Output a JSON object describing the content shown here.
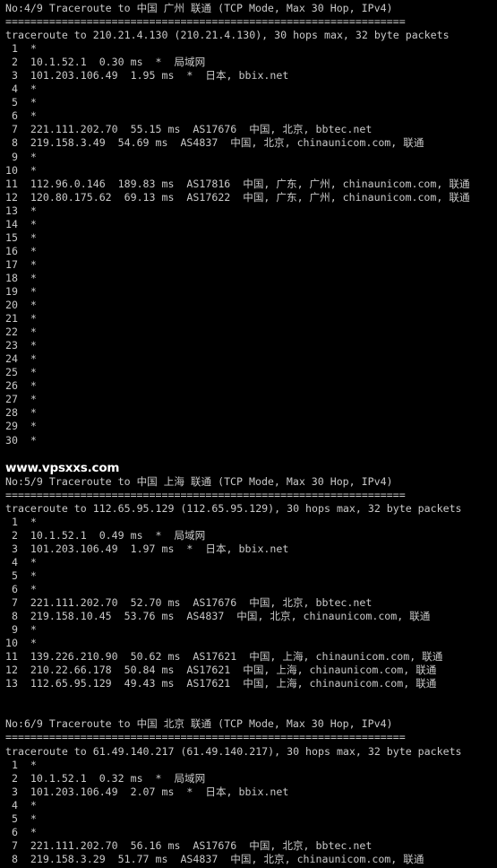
{
  "terminal": {
    "background_color": "#000000",
    "text_color": "#c9c9c9",
    "watermark_color": "#ffffff"
  },
  "watermark": {
    "text": "www.vpsxxs.com"
  },
  "sections": [
    {
      "header": "No:4/9 Traceroute to 中国 广州 联通 (TCP Mode, Max 30 Hop, IPv4)",
      "separator": "================================================================",
      "summary": "traceroute to 210.21.4.130 (210.21.4.130), 30 hops max, 32 byte packets",
      "target_ip": "210.21.4.130",
      "max_hops": "30",
      "packet_size": "32 byte",
      "hops": [
        " 1  *",
        " 2  10.1.52.1  0.30 ms  *  局域网",
        " 3  101.203.106.49  1.95 ms  *  日本, bbix.net",
        " 4  *",
        " 5  *",
        " 6  *",
        " 7  221.111.202.70  55.15 ms  AS17676  中国, 北京, bbtec.net",
        " 8  219.158.3.49  54.69 ms  AS4837  中国, 北京, chinaunicom.com, 联通",
        " 9  *",
        "10  *",
        "11  112.96.0.146  189.83 ms  AS17816  中国, 广东, 广州, chinaunicom.com, 联通",
        "12  120.80.175.62  69.13 ms  AS17622  中国, 广东, 广州, chinaunicom.com, 联通",
        "13  *",
        "14  *",
        "15  *",
        "16  *",
        "17  *",
        "18  *",
        "19  *",
        "20  *",
        "21  *",
        "22  *",
        "23  *",
        "24  *",
        "25  *",
        "26  *",
        "27  *",
        "28  *",
        "29  *",
        "30  *"
      ]
    },
    {
      "header": "No:5/9 Traceroute to 中国 上海 联通 (TCP Mode, Max 30 Hop, IPv4)",
      "separator": "================================================================",
      "summary": "traceroute to 112.65.95.129 (112.65.95.129), 30 hops max, 32 byte packets",
      "target_ip": "112.65.95.129",
      "max_hops": "30",
      "packet_size": "32 byte",
      "hops": [
        " 1  *",
        " 2  10.1.52.1  0.49 ms  *  局域网",
        " 3  101.203.106.49  1.97 ms  *  日本, bbix.net",
        " 4  *",
        " 5  *",
        " 6  *",
        " 7  221.111.202.70  52.70 ms  AS17676  中国, 北京, bbtec.net",
        " 8  219.158.10.45  53.76 ms  AS4837  中国, 北京, chinaunicom.com, 联通",
        " 9  *",
        "10  *",
        "11  139.226.210.90  50.62 ms  AS17621  中国, 上海, chinaunicom.com, 联通",
        "12  210.22.66.178  50.84 ms  AS17621  中国, 上海, chinaunicom.com, 联通",
        "13  112.65.95.129  49.43 ms  AS17621  中国, 上海, chinaunicom.com, 联通"
      ]
    },
    {
      "header": "No:6/9 Traceroute to 中国 北京 联通 (TCP Mode, Max 30 Hop, IPv4)",
      "separator": "================================================================",
      "summary": "traceroute to 61.49.140.217 (61.49.140.217), 30 hops max, 32 byte packets",
      "target_ip": "61.49.140.217",
      "max_hops": "30",
      "packet_size": "32 byte",
      "hops": [
        " 1  *",
        " 2  10.1.52.1  0.32 ms  *  局域网",
        " 3  101.203.106.49  2.07 ms  *  日本, bbix.net",
        " 4  *",
        " 5  *",
        " 6  *",
        " 7  221.111.202.70  56.16 ms  AS17676  中国, 北京, bbtec.net",
        " 8  219.158.3.29  51.77 ms  AS4837  中国, 北京, chinaunicom.com, 联通"
      ]
    }
  ]
}
